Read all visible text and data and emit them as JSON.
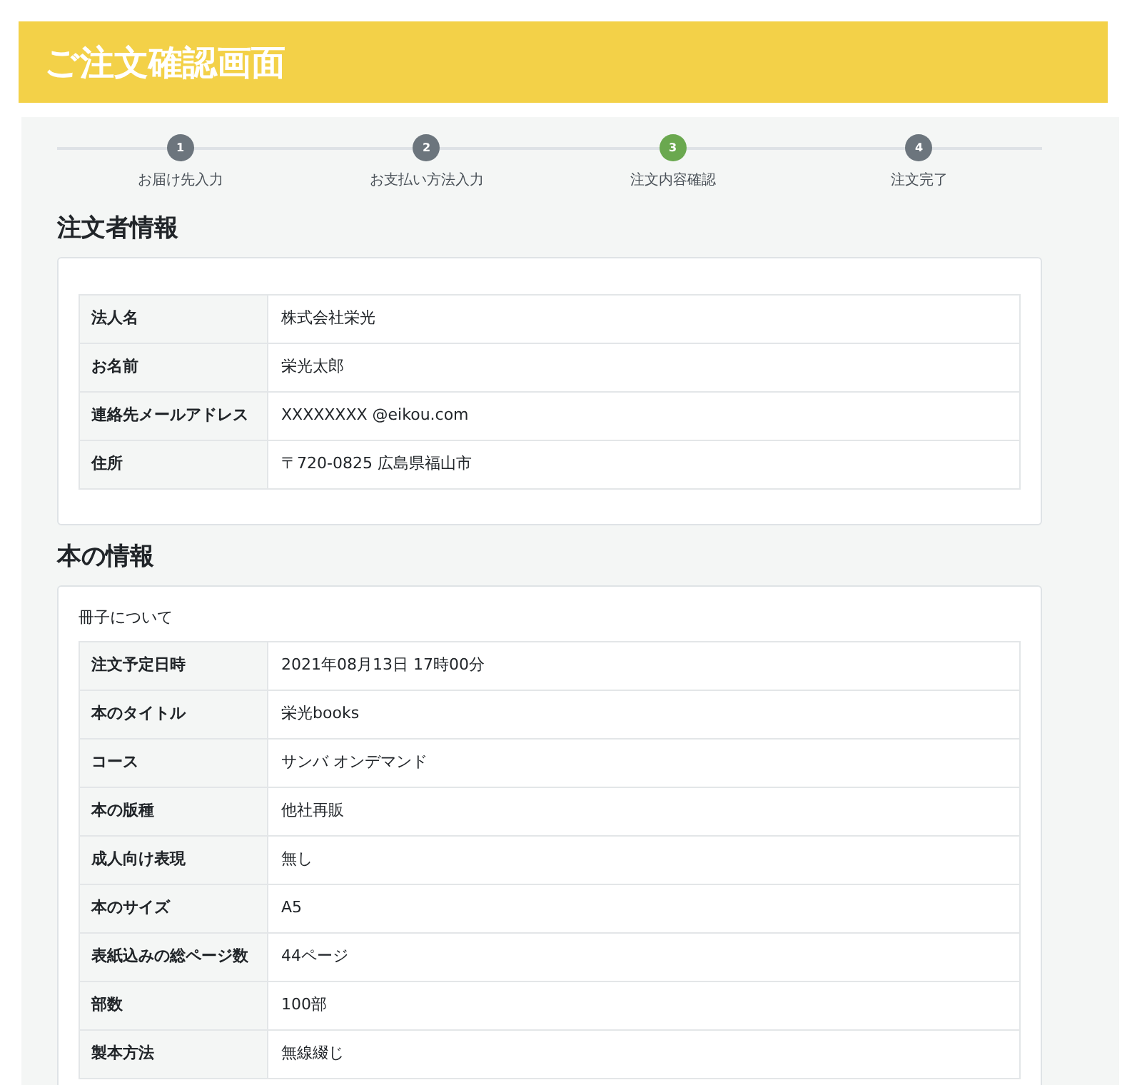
{
  "header": {
    "title": "ご注文確認画面"
  },
  "steps": [
    {
      "number": "1",
      "label": "お届け先入力",
      "selected": false
    },
    {
      "number": "2",
      "label": "お支払い方法入力",
      "selected": false
    },
    {
      "number": "3",
      "label": "注文内容確認",
      "selected": true
    },
    {
      "number": "4",
      "label": "注文完了",
      "selected": false
    }
  ],
  "sections": [
    {
      "title": "注文者情報",
      "rows": [
        {
          "label": "法人名",
          "value": "株式会社栄光"
        },
        {
          "label": "お名前",
          "value": "栄光太郎"
        },
        {
          "label": "連絡先メールアドレス",
          "value": "XXXXXXXX @eikou.com"
        },
        {
          "label": "住所",
          "value": "〒720-0825 広島県福山市"
        }
      ]
    },
    {
      "title": "本の情報",
      "subtitle": "冊子について",
      "rows": [
        {
          "label": "注文予定日時",
          "value": "2021年08月13日 17時00分"
        },
        {
          "label": "本のタイトル",
          "value": "栄光books"
        },
        {
          "label": "コース",
          "value": "サンバ オンデマンド"
        },
        {
          "label": "本の版種",
          "value": "他社再販"
        },
        {
          "label": "成人向け表現",
          "value": "無し"
        },
        {
          "label": "本のサイズ",
          "value": "A5"
        },
        {
          "label": "表紙込みの総ページ数",
          "value": "44ページ"
        },
        {
          "label": "部数",
          "value": "100部"
        },
        {
          "label": "製本方法",
          "value": "無線綴じ"
        }
      ]
    }
  ]
}
